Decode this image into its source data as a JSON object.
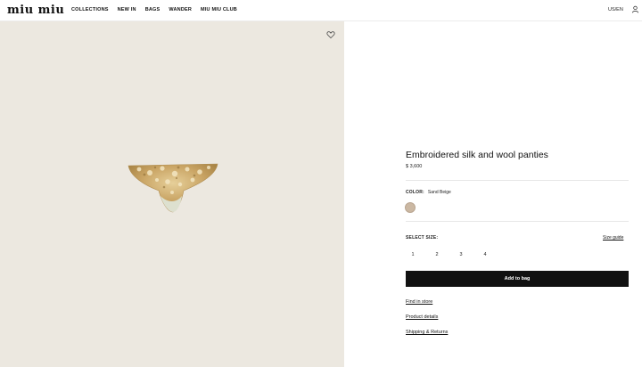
{
  "header": {
    "logo": "miu miu",
    "nav": [
      "COLLECTIONS",
      "NEW IN",
      "BAGS",
      "WANDER",
      "MIU MIU CLUB"
    ],
    "locale": "US/EN"
  },
  "product": {
    "title": "Embroidered silk and wool panties",
    "price": "$ 3,600",
    "color_label": "COLOR:",
    "color_value": "Sand Beige",
    "swatch_color": "#cbb8a3",
    "size_label": "SELECT SIZE:",
    "size_guide": "Size guide",
    "sizes": [
      "1",
      "2",
      "3",
      "4"
    ],
    "add_to_bag": "Add to bag"
  },
  "links": {
    "find_in_store": "Find in store",
    "product_details": "Product details",
    "shipping": "Shipping & Returns"
  },
  "icons": {
    "user": "user-icon",
    "wishlist": "heart-icon"
  },
  "colors": {
    "image_bg": "#ece8e0",
    "button_bg": "#111111"
  }
}
